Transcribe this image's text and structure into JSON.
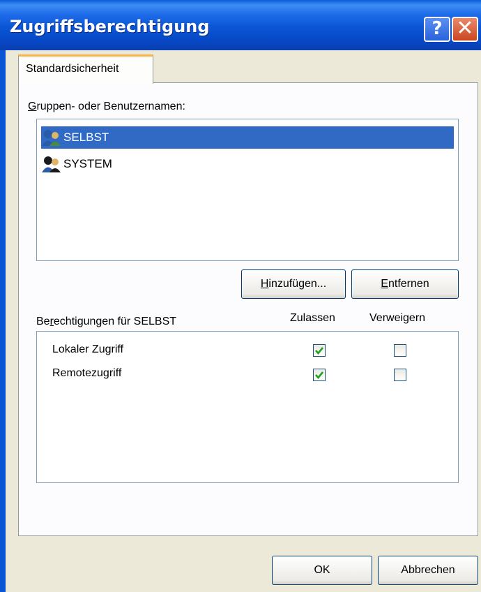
{
  "window": {
    "title": "Zugriffsberechtigung",
    "help_glyph": "?",
    "close_glyph": "✕"
  },
  "tabs": [
    {
      "label": "Standardsicherheit"
    }
  ],
  "groups": {
    "label_first": "G",
    "label_rest": "ruppen- oder Benutzernamen:",
    "items": [
      {
        "name": "SELBST",
        "icon": "users-icon",
        "selected": true
      },
      {
        "name": "SYSTEM",
        "icon": "users-icon",
        "selected": false
      }
    ]
  },
  "buttons": {
    "add_first": "H",
    "add_rest": "inzufügen...",
    "remove_first": "E",
    "remove_rest": "ntfernen",
    "ok": "OK",
    "cancel": "Abbrechen"
  },
  "permissions": {
    "label_pre": "Be",
    "label_u": "r",
    "label_post": "echtigungen für SELBST",
    "col_allow": "Zulassen",
    "col_deny": "Verweigern",
    "rows": [
      {
        "name": "Lokaler Zugriff",
        "allow": true,
        "deny": false
      },
      {
        "name": "Remotezugriff",
        "allow": true,
        "deny": false
      }
    ]
  },
  "colors": {
    "titlebar": "#0a55d4",
    "selection": "#316ac5",
    "check": "#21a121",
    "tab_highlight": "#f7b34a"
  }
}
